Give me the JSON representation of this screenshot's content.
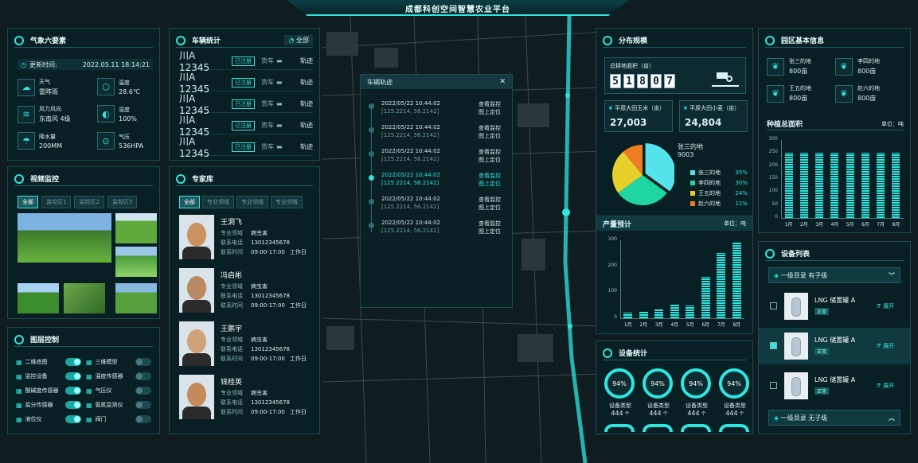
{
  "header": {
    "title": "成都科创空间智慧农业平台"
  },
  "weather": {
    "title": "气象六要素",
    "update_label": "更新时间:",
    "update_time": "2022.05.11 18:14:21",
    "items": [
      {
        "label": "天气",
        "value": "雷阵雨",
        "icon": "cloud-icon"
      },
      {
        "label": "温度",
        "value": "28.6℃",
        "icon": "thermometer-icon"
      },
      {
        "label": "风力风向",
        "value": "东南风 4级",
        "icon": "wind-icon"
      },
      {
        "label": "湿度",
        "value": "100%",
        "icon": "droplet-icon"
      },
      {
        "label": "降水量",
        "value": "200MM",
        "icon": "rain-icon"
      },
      {
        "label": "气压",
        "value": "536HPA",
        "icon": "pressure-icon"
      }
    ]
  },
  "vehicles": {
    "title": "车辆统计",
    "filter": "全部",
    "rows": [
      {
        "plate": "川A 12345",
        "status": "已注册",
        "type": "货车",
        "action": "轨迹"
      },
      {
        "plate": "川A 12345",
        "status": "已注册",
        "type": "货车",
        "action": "轨迹"
      },
      {
        "plate": "川A 12345",
        "status": "已注册",
        "type": "货车",
        "action": "轨迹"
      },
      {
        "plate": "川A 12345",
        "status": "已注册",
        "type": "货车",
        "action": "轨迹"
      },
      {
        "plate": "川A 12345",
        "status": "已注册",
        "type": "货车",
        "action": "轨迹"
      }
    ]
  },
  "video": {
    "title": "视频监控",
    "tabs": [
      "全部",
      "监控区1",
      "监控区2",
      "监控区3"
    ]
  },
  "layers": {
    "title": "图层控制",
    "items": [
      {
        "label": "二维底图",
        "on": true
      },
      {
        "label": "三维模型",
        "on": false
      },
      {
        "label": "监控设备",
        "on": true
      },
      {
        "label": "温度传感器",
        "on": false
      },
      {
        "label": "酸碱度传感器",
        "on": true
      },
      {
        "label": "气压仪",
        "on": false
      },
      {
        "label": "盐分传感器",
        "on": true
      },
      {
        "label": "氨氮监测仪",
        "on": false
      },
      {
        "label": "液位仪",
        "on": true
      },
      {
        "label": "阀门",
        "on": false
      }
    ]
  },
  "experts": {
    "title": "专家库",
    "tabs": [
      "全部",
      "专业领域",
      "专业领域",
      "专业领域"
    ],
    "field_label": "专业领域",
    "phone_label": "联系电话",
    "hours_label": "联系时间",
    "list": [
      {
        "name": "王洞飞",
        "field": "病虫害",
        "phone": "13012345678",
        "hours": "09:00-17:00",
        "day": "工作日"
      },
      {
        "name": "冯启彬",
        "field": "病虫害",
        "phone": "13012345678",
        "hours": "09:00-17:00",
        "day": "工作日"
      },
      {
        "name": "王鹏宇",
        "field": "病虫害",
        "phone": "13012345678",
        "hours": "09:00-17:00",
        "day": "工作日"
      },
      {
        "name": "钱桂英",
        "field": "病虫害",
        "phone": "13012345678",
        "hours": "09:00-17:00",
        "day": "工作日"
      }
    ]
  },
  "track": {
    "title": "车辆轨迹",
    "close": "✕",
    "points": [
      {
        "time": "2022/05/22 10:44:02",
        "coord": "[125.2214, 56.2142]",
        "a1": "查看监控",
        "a2": "图上定位",
        "active": false
      },
      {
        "time": "2022/05/22 10:44:02",
        "coord": "[125.2214, 56.2142]",
        "a1": "查看监控",
        "a2": "图上定位",
        "active": false
      },
      {
        "time": "2022/05/22 10:44:02",
        "coord": "[125.2214, 56.2142]",
        "a1": "查看监控",
        "a2": "图上定位",
        "active": false
      },
      {
        "time": "2022/05/22 10:44:02",
        "coord": "[125.2214, 56.2142]",
        "a1": "查看监控",
        "a2": "图上定位",
        "active": true
      },
      {
        "time": "2022/05/22 10:44:02",
        "coord": "[125.2214, 56.2142]",
        "a1": "查看监控",
        "a2": "图上定位",
        "active": false
      },
      {
        "time": "2022/05/22 10:44:02",
        "coord": "[125.2214, 56.2142]",
        "a1": "查看监控",
        "a2": "图上定位",
        "active": false
      }
    ]
  },
  "distribution": {
    "title": "分布规模",
    "total_label": "总耕地面积（亩）",
    "digits": [
      "5",
      "1",
      "8",
      "0",
      "7"
    ],
    "corn_label": "平原大田玉米（亩）",
    "corn_value": "27,003",
    "wheat_label": "平原大田小麦（亩）",
    "wheat_value": "24,804",
    "pie_callout_name": "张三的地",
    "pie_callout_value": "9003",
    "pie": [
      {
        "name": "张三的地",
        "pct": "35%",
        "value": 35,
        "color": "#56e4ec"
      },
      {
        "name": "李四的地",
        "pct": "30%",
        "value": 30,
        "color": "#1fd6a2"
      },
      {
        "name": "王五的地",
        "pct": "24%",
        "value": 24,
        "color": "#e8cf2c"
      },
      {
        "name": "赵六的地",
        "pct": "11%",
        "value": 11,
        "color": "#f07d24"
      }
    ]
  },
  "yield": {
    "title": "产量预计",
    "unit": "单位：吨",
    "chart_data": {
      "type": "bar",
      "categories": [
        "1月",
        "2月",
        "3月",
        "4月",
        "5月",
        "6月",
        "7月",
        "8月"
      ],
      "values": [
        20,
        25,
        35,
        55,
        50,
        160,
        250,
        290
      ],
      "ylim": [
        0,
        300
      ],
      "yticks": [
        "0",
        "100",
        "200",
        "300"
      ]
    }
  },
  "garden": {
    "title": "园区基本信息",
    "items": [
      {
        "name": "张三的地",
        "value": "800亩"
      },
      {
        "name": "李四的地",
        "value": "800亩"
      },
      {
        "name": "王五的地",
        "value": "800亩"
      },
      {
        "name": "赵六的地",
        "value": "800亩"
      }
    ],
    "area_title": "种植总面积",
    "unit": "单位：吨",
    "chart_data": {
      "type": "bar",
      "categories": [
        "1月",
        "2月",
        "3月",
        "4月",
        "5月",
        "6月",
        "7月",
        "8月"
      ],
      "values": [
        250,
        250,
        250,
        250,
        250,
        250,
        250,
        250
      ],
      "ylim": [
        0,
        300
      ],
      "yticks": [
        "0",
        "50",
        "100",
        "150",
        "200",
        "250",
        "300"
      ]
    }
  },
  "devices": {
    "title": "设备列表",
    "group1": "一级目录 有子级",
    "group2": "一级目录 无子级",
    "items": [
      {
        "name": "LNG 储置罐 A",
        "status": "正常",
        "action": "展开",
        "checked": false
      },
      {
        "name": "LNG 储置罐 A",
        "status": "正常",
        "action": "展开",
        "checked": true
      },
      {
        "name": "LNG 储置罐 A",
        "status": "正常",
        "action": "展开",
        "checked": false
      }
    ]
  },
  "equipment": {
    "title": "设备统计",
    "items": [
      {
        "pct": "94%",
        "type": "设备类型",
        "count": "444",
        "unit": "个"
      },
      {
        "pct": "94%",
        "type": "设备类型",
        "count": "444",
        "unit": "个"
      },
      {
        "pct": "94%",
        "type": "设备类型",
        "count": "444",
        "unit": "个"
      },
      {
        "pct": "94%",
        "type": "设备类型",
        "count": "444",
        "unit": "个"
      }
    ]
  }
}
